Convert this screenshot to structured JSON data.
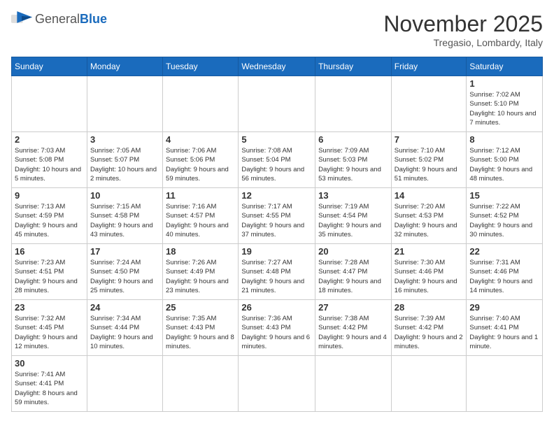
{
  "header": {
    "logo_general": "General",
    "logo_blue": "Blue",
    "month_title": "November 2025",
    "location": "Tregasio, Lombardy, Italy"
  },
  "days_of_week": [
    "Sunday",
    "Monday",
    "Tuesday",
    "Wednesday",
    "Thursday",
    "Friday",
    "Saturday"
  ],
  "weeks": [
    [
      {
        "day": "",
        "info": ""
      },
      {
        "day": "",
        "info": ""
      },
      {
        "day": "",
        "info": ""
      },
      {
        "day": "",
        "info": ""
      },
      {
        "day": "",
        "info": ""
      },
      {
        "day": "",
        "info": ""
      },
      {
        "day": "1",
        "info": "Sunrise: 7:02 AM\nSunset: 5:10 PM\nDaylight: 10 hours and 7 minutes."
      }
    ],
    [
      {
        "day": "2",
        "info": "Sunrise: 7:03 AM\nSunset: 5:08 PM\nDaylight: 10 hours and 5 minutes."
      },
      {
        "day": "3",
        "info": "Sunrise: 7:05 AM\nSunset: 5:07 PM\nDaylight: 10 hours and 2 minutes."
      },
      {
        "day": "4",
        "info": "Sunrise: 7:06 AM\nSunset: 5:06 PM\nDaylight: 9 hours and 59 minutes."
      },
      {
        "day": "5",
        "info": "Sunrise: 7:08 AM\nSunset: 5:04 PM\nDaylight: 9 hours and 56 minutes."
      },
      {
        "day": "6",
        "info": "Sunrise: 7:09 AM\nSunset: 5:03 PM\nDaylight: 9 hours and 53 minutes."
      },
      {
        "day": "7",
        "info": "Sunrise: 7:10 AM\nSunset: 5:02 PM\nDaylight: 9 hours and 51 minutes."
      },
      {
        "day": "8",
        "info": "Sunrise: 7:12 AM\nSunset: 5:00 PM\nDaylight: 9 hours and 48 minutes."
      }
    ],
    [
      {
        "day": "9",
        "info": "Sunrise: 7:13 AM\nSunset: 4:59 PM\nDaylight: 9 hours and 45 minutes."
      },
      {
        "day": "10",
        "info": "Sunrise: 7:15 AM\nSunset: 4:58 PM\nDaylight: 9 hours and 43 minutes."
      },
      {
        "day": "11",
        "info": "Sunrise: 7:16 AM\nSunset: 4:57 PM\nDaylight: 9 hours and 40 minutes."
      },
      {
        "day": "12",
        "info": "Sunrise: 7:17 AM\nSunset: 4:55 PM\nDaylight: 9 hours and 37 minutes."
      },
      {
        "day": "13",
        "info": "Sunrise: 7:19 AM\nSunset: 4:54 PM\nDaylight: 9 hours and 35 minutes."
      },
      {
        "day": "14",
        "info": "Sunrise: 7:20 AM\nSunset: 4:53 PM\nDaylight: 9 hours and 32 minutes."
      },
      {
        "day": "15",
        "info": "Sunrise: 7:22 AM\nSunset: 4:52 PM\nDaylight: 9 hours and 30 minutes."
      }
    ],
    [
      {
        "day": "16",
        "info": "Sunrise: 7:23 AM\nSunset: 4:51 PM\nDaylight: 9 hours and 28 minutes."
      },
      {
        "day": "17",
        "info": "Sunrise: 7:24 AM\nSunset: 4:50 PM\nDaylight: 9 hours and 25 minutes."
      },
      {
        "day": "18",
        "info": "Sunrise: 7:26 AM\nSunset: 4:49 PM\nDaylight: 9 hours and 23 minutes."
      },
      {
        "day": "19",
        "info": "Sunrise: 7:27 AM\nSunset: 4:48 PM\nDaylight: 9 hours and 21 minutes."
      },
      {
        "day": "20",
        "info": "Sunrise: 7:28 AM\nSunset: 4:47 PM\nDaylight: 9 hours and 18 minutes."
      },
      {
        "day": "21",
        "info": "Sunrise: 7:30 AM\nSunset: 4:46 PM\nDaylight: 9 hours and 16 minutes."
      },
      {
        "day": "22",
        "info": "Sunrise: 7:31 AM\nSunset: 4:46 PM\nDaylight: 9 hours and 14 minutes."
      }
    ],
    [
      {
        "day": "23",
        "info": "Sunrise: 7:32 AM\nSunset: 4:45 PM\nDaylight: 9 hours and 12 minutes."
      },
      {
        "day": "24",
        "info": "Sunrise: 7:34 AM\nSunset: 4:44 PM\nDaylight: 9 hours and 10 minutes."
      },
      {
        "day": "25",
        "info": "Sunrise: 7:35 AM\nSunset: 4:43 PM\nDaylight: 9 hours and 8 minutes."
      },
      {
        "day": "26",
        "info": "Sunrise: 7:36 AM\nSunset: 4:43 PM\nDaylight: 9 hours and 6 minutes."
      },
      {
        "day": "27",
        "info": "Sunrise: 7:38 AM\nSunset: 4:42 PM\nDaylight: 9 hours and 4 minutes."
      },
      {
        "day": "28",
        "info": "Sunrise: 7:39 AM\nSunset: 4:42 PM\nDaylight: 9 hours and 2 minutes."
      },
      {
        "day": "29",
        "info": "Sunrise: 7:40 AM\nSunset: 4:41 PM\nDaylight: 9 hours and 1 minute."
      }
    ],
    [
      {
        "day": "30",
        "info": "Sunrise: 7:41 AM\nSunset: 4:41 PM\nDaylight: 8 hours and 59 minutes."
      },
      {
        "day": "",
        "info": ""
      },
      {
        "day": "",
        "info": ""
      },
      {
        "day": "",
        "info": ""
      },
      {
        "day": "",
        "info": ""
      },
      {
        "day": "",
        "info": ""
      },
      {
        "day": "",
        "info": ""
      }
    ]
  ]
}
